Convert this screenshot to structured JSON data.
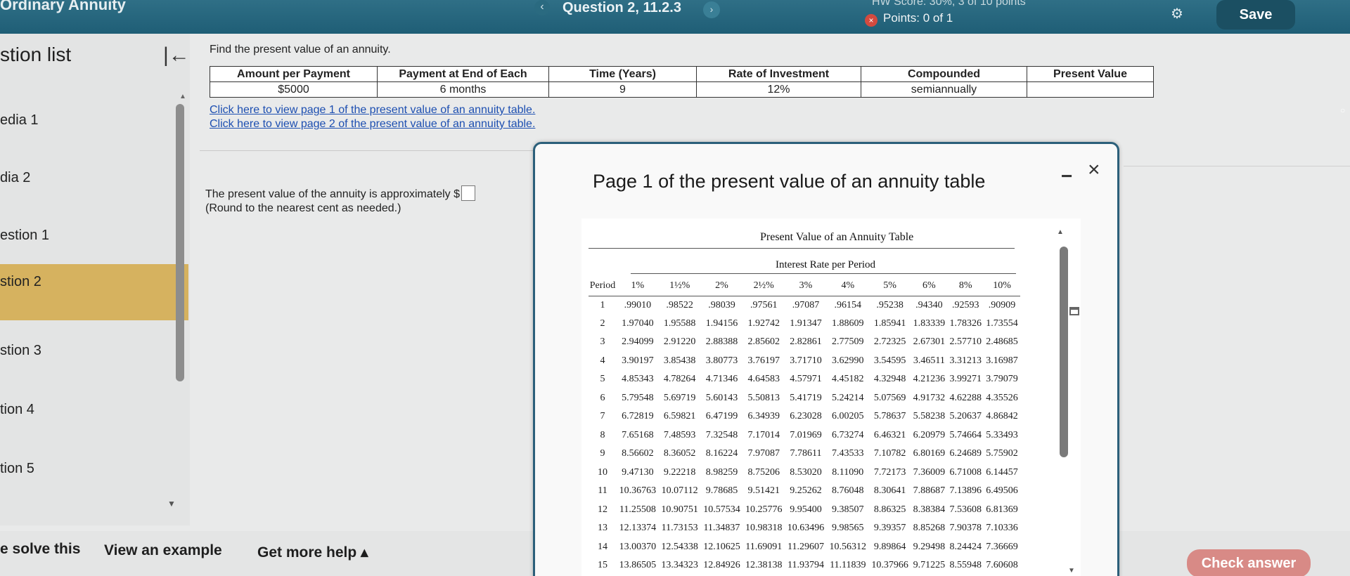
{
  "topbar": {
    "app_title": "Ordinary Annuity",
    "question_label": "Question 2, 11.2.3",
    "hw_score": "HW Score: 30%, 3 of 10 points",
    "points": "Points: 0 of 1",
    "save_label": "Save",
    "prev_glyph": "‹",
    "next_glyph": "›",
    "points_icon": "×",
    "settings_glyph": "⚙"
  },
  "sidebar": {
    "heading": "stion list",
    "collapse_glyph": "|←",
    "items": [
      {
        "label": "edia 1",
        "active": false
      },
      {
        "label": "dia 2",
        "active": false
      },
      {
        "label": "estion 1",
        "active": false
      },
      {
        "label": "stion 2",
        "active": true
      },
      {
        "label": "stion 3",
        "active": false
      },
      {
        "label": "tion 4",
        "active": false
      },
      {
        "label": "tion 5",
        "active": false
      }
    ],
    "active_color": "#d6b25f"
  },
  "main": {
    "prompt": "Find the present value of an annuity.",
    "table_headers": [
      "Amount per Payment",
      "Payment at End of Each",
      "Time (Years)",
      "Rate of Investment",
      "Compounded",
      "Present Value"
    ],
    "table_values": [
      "$5000",
      "6 months",
      "9",
      "12%",
      "semiannually",
      ""
    ],
    "link1": "Click here to view page 1 of the present value of an annuity table.",
    "link2": "Click here to view page 2 of the present value of an annuity table.",
    "answer_prefix": "The present value of the annuity is approximately $",
    "round_note": "(Round to the nearest cent as needed.)"
  },
  "bottombar": {
    "help_solve": "e solve this",
    "view_example": "View an example",
    "get_more_help": "Get more help ▴",
    "check_answer": "Check answer",
    "check_color": "#d88a86"
  },
  "modal": {
    "title": "Page 1 of the present value of an annuity table",
    "minimize_glyph": "−",
    "close_glyph": "×",
    "table_title": "Present Value of an Annuity Table",
    "table_subtitle": "Interest Rate per Period",
    "columns": [
      "Period",
      "1%",
      "1½%",
      "2%",
      "2½%",
      "3%",
      "4%",
      "5%",
      "6%",
      "8%",
      "10%"
    ],
    "rows": [
      [
        "1",
        ".99010",
        ".98522",
        ".98039",
        ".97561",
        ".97087",
        ".96154",
        ".95238",
        ".94340",
        ".92593",
        ".90909"
      ],
      [
        "2",
        "1.97040",
        "1.95588",
        "1.94156",
        "1.92742",
        "1.91347",
        "1.88609",
        "1.85941",
        "1.83339",
        "1.78326",
        "1.73554"
      ],
      [
        "3",
        "2.94099",
        "2.91220",
        "2.88388",
        "2.85602",
        "2.82861",
        "2.77509",
        "2.72325",
        "2.67301",
        "2.57710",
        "2.48685"
      ],
      [
        "4",
        "3.90197",
        "3.85438",
        "3.80773",
        "3.76197",
        "3.71710",
        "3.62990",
        "3.54595",
        "3.46511",
        "3.31213",
        "3.16987"
      ],
      [
        "5",
        "4.85343",
        "4.78264",
        "4.71346",
        "4.64583",
        "4.57971",
        "4.45182",
        "4.32948",
        "4.21236",
        "3.99271",
        "3.79079"
      ],
      [
        "6",
        "5.79548",
        "5.69719",
        "5.60143",
        "5.50813",
        "5.41719",
        "5.24214",
        "5.07569",
        "4.91732",
        "4.62288",
        "4.35526"
      ],
      [
        "7",
        "6.72819",
        "6.59821",
        "6.47199",
        "6.34939",
        "6.23028",
        "6.00205",
        "5.78637",
        "5.58238",
        "5.20637",
        "4.86842"
      ],
      [
        "8",
        "7.65168",
        "7.48593",
        "7.32548",
        "7.17014",
        "7.01969",
        "6.73274",
        "6.46321",
        "6.20979",
        "5.74664",
        "5.33493"
      ],
      [
        "9",
        "8.56602",
        "8.36052",
        "8.16224",
        "7.97087",
        "7.78611",
        "7.43533",
        "7.10782",
        "6.80169",
        "6.24689",
        "5.75902"
      ],
      [
        "10",
        "9.47130",
        "9.22218",
        "8.98259",
        "8.75206",
        "8.53020",
        "8.11090",
        "7.72173",
        "7.36009",
        "6.71008",
        "6.14457"
      ],
      [
        "11",
        "10.36763",
        "10.07112",
        "9.78685",
        "9.51421",
        "9.25262",
        "8.76048",
        "8.30641",
        "7.88687",
        "7.13896",
        "6.49506"
      ],
      [
        "12",
        "11.25508",
        "10.90751",
        "10.57534",
        "10.25776",
        "9.95400",
        "9.38507",
        "8.86325",
        "8.38384",
        "7.53608",
        "6.81369"
      ],
      [
        "13",
        "12.13374",
        "11.73153",
        "11.34837",
        "10.98318",
        "10.63496",
        "9.98565",
        "9.39357",
        "8.85268",
        "7.90378",
        "7.10336"
      ],
      [
        "14",
        "13.00370",
        "12.54338",
        "12.10625",
        "11.69091",
        "11.29607",
        "10.56312",
        "9.89864",
        "9.29498",
        "8.24424",
        "7.36669"
      ],
      [
        "15",
        "13.86505",
        "13.34323",
        "12.84926",
        "12.38138",
        "11.93794",
        "11.11839",
        "10.37966",
        "9.71225",
        "8.55948",
        "7.60608"
      ]
    ]
  }
}
